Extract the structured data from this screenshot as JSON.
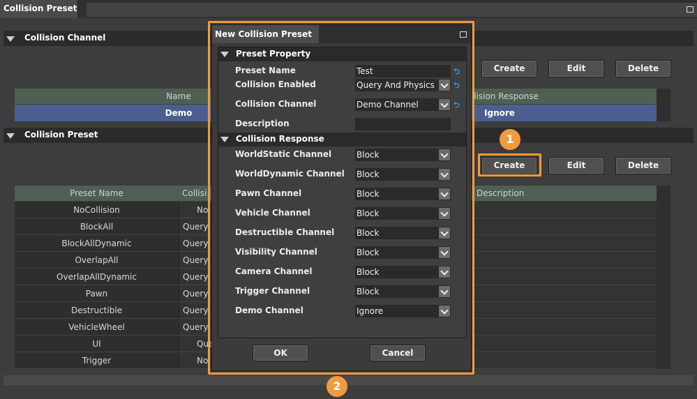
{
  "window": {
    "tab_title": "Collision Preset"
  },
  "channel_section": {
    "title": "Collision Channel",
    "buttons": {
      "create": "Create",
      "edit": "Edit",
      "delete": "Delete"
    },
    "columns": {
      "name": "Name",
      "response": "Collision Response"
    },
    "rows": [
      {
        "name": "Demo",
        "response": "Ignore"
      }
    ]
  },
  "preset_section": {
    "title": "Collision Preset",
    "buttons": {
      "create": "Create",
      "edit": "Edit",
      "delete": "Delete"
    },
    "columns": {
      "preset_name": "Preset Name",
      "collision": "Collisi",
      "description": "Description"
    },
    "rows": [
      {
        "name": "NoCollision",
        "collision": "No"
      },
      {
        "name": "BlockAll",
        "collision": "Query"
      },
      {
        "name": "BlockAllDynamic",
        "collision": "Query"
      },
      {
        "name": "OverlapAll",
        "collision": "Query"
      },
      {
        "name": "OverlapAllDynamic",
        "collision": "Query"
      },
      {
        "name": "Pawn",
        "collision": "Query"
      },
      {
        "name": "Destructible",
        "collision": "Query"
      },
      {
        "name": "VehicleWheel",
        "collision": "Query"
      },
      {
        "name": "UI",
        "collision": "Que"
      },
      {
        "name": "Trigger",
        "collision": "No"
      }
    ]
  },
  "callouts": {
    "one": "1",
    "two": "2"
  },
  "dialog": {
    "title": "New Collision Preset",
    "property_section": "Preset Property",
    "fields": {
      "preset_name": {
        "label": "Preset Name",
        "value": "Test"
      },
      "collision_enabled": {
        "label": "Collision Enabled",
        "value": "Query And Physics"
      },
      "collision_channel": {
        "label": "Collision Channel",
        "value": "Demo Channel"
      },
      "description": {
        "label": "Description",
        "value": ""
      }
    },
    "response_section": "Collision Response",
    "responses": [
      {
        "label": "WorldStatic Channel",
        "value": "Block"
      },
      {
        "label": "WorldDynamic Channel",
        "value": "Block"
      },
      {
        "label": "Pawn Channel",
        "value": "Block"
      },
      {
        "label": "Vehicle Channel",
        "value": "Block"
      },
      {
        "label": "Destructible Channel",
        "value": "Block"
      },
      {
        "label": "Visibility Channel",
        "value": "Block"
      },
      {
        "label": "Camera Channel",
        "value": "Block"
      },
      {
        "label": "Trigger Channel",
        "value": "Block"
      },
      {
        "label": "Demo Channel",
        "value": "Ignore"
      }
    ],
    "ok": "OK",
    "cancel": "Cancel"
  },
  "colors": {
    "highlight": "#f29b3d",
    "selected_row": "#4b5f8f",
    "header": "#4e5f53",
    "link": "#2f9dff"
  }
}
